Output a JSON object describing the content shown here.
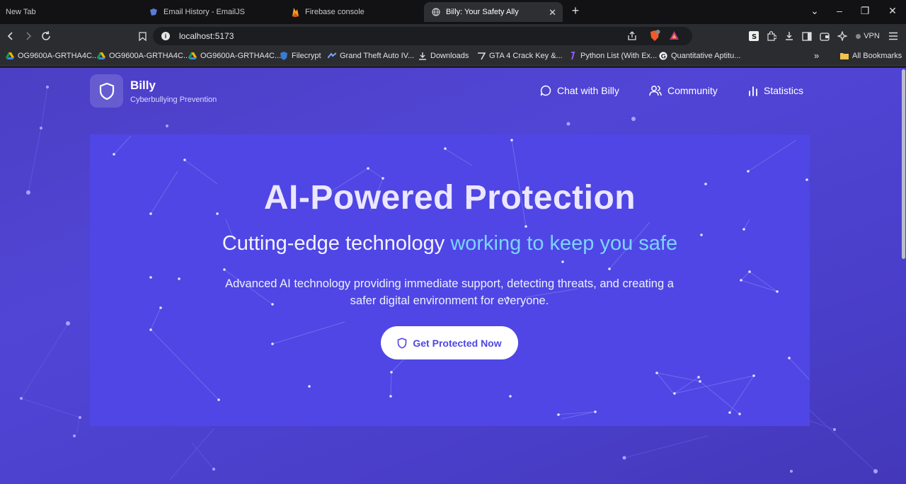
{
  "browser": {
    "tabs": [
      {
        "label": "New Tab",
        "active": false
      },
      {
        "label": "Email History - EmailJS",
        "active": false
      },
      {
        "label": "Firebase console",
        "active": false
      },
      {
        "label": "Billy: Your Safety Ally",
        "active": true
      }
    ],
    "url": "localhost:5173",
    "vpn_label": "VPN",
    "bookmarks": [
      "OG9600A-GRTHA4C...",
      "OG9600A-GRTHA4C...",
      "OG9600A-GRTHA4C...",
      "Filecrypt",
      "Grand Theft Auto IV...",
      "Downloads",
      "GTA 4 Crack Key &...",
      "Python List (With Ex...",
      "Quantitative Aptitu..."
    ],
    "bookmarks_overflow": "»",
    "all_bookmarks": "All Bookmarks"
  },
  "site": {
    "brand_name": "Billy",
    "brand_tagline": "Cyberbullying Prevention",
    "nav": {
      "chat": "Chat with Billy",
      "community": "Community",
      "statistics": "Statistics"
    },
    "hero": {
      "title": "AI-Powered Protection",
      "subtitle_plain": "Cutting-edge technology ",
      "subtitle_accent": "working to keep you safe",
      "description": "Advanced AI technology providing immediate support, detecting threats, and creating a safer digital environment for everyone.",
      "cta": "Get Protected Now"
    }
  },
  "colors": {
    "page_bg": "#4b3fc4",
    "hero_bg": "#4f46e5",
    "accent": "#7dd3fc",
    "cta_text": "#4f46e5"
  }
}
